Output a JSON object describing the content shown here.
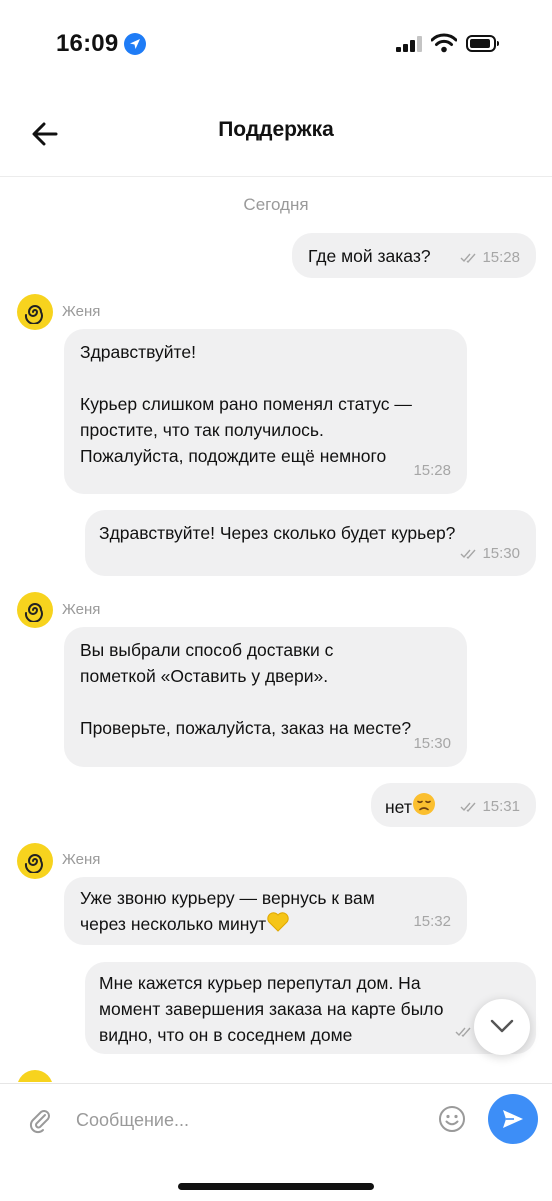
{
  "status_bar": {
    "time": "16:09"
  },
  "header": {
    "title": "Поддержка"
  },
  "chat": {
    "date": "Сегодня",
    "messages": [
      {
        "from": "me",
        "text": "Где мой заказ?",
        "time": "15:28"
      },
      {
        "from": "agent",
        "sender": "Женя",
        "text": "Здравствуйте!\n\nКурьер слишком рано поменял статус —\nпростите, что так получилось.\nПожалуйста, подождите ещё немного",
        "time": "15:28"
      },
      {
        "from": "me",
        "text": "Здравствуйте! Через сколько будет курьер?",
        "time": "15:30"
      },
      {
        "from": "agent",
        "sender": "Женя",
        "text": "Вы выбрали способ доставки с\nпометкой «Оставить у двери».\n\nПроверьте, пожалуйста, заказ на месте?",
        "time": "15:30"
      },
      {
        "from": "me",
        "text": "нет",
        "emoji": "disappointed-face",
        "time": "15:31"
      },
      {
        "from": "agent",
        "sender": "Женя",
        "text": "Уже звоню курьеру — вернусь к вам\nчерез несколько минут",
        "emoji": "yellow-heart",
        "time": "15:32"
      },
      {
        "from": "me",
        "text": "Мне кажется курьер перепутал дом. На\nмомент завершения заказа на карте было\nвидно, что он в соседнем доме"
      }
    ]
  },
  "composer": {
    "placeholder": "Сообщение..."
  },
  "colors": {
    "accent": "#3d8ef7",
    "avatar": "#f7d31e",
    "bubble": "#f0f0f1",
    "muted": "#9a9a9a"
  }
}
